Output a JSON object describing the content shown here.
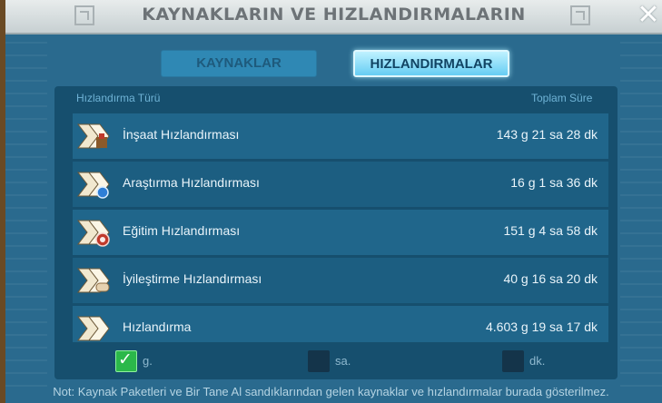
{
  "header": {
    "title": "KAYNAKLARIN VE HIZLANDIRMALARIN",
    "close_icon": "close-icon"
  },
  "tabs": [
    {
      "label": "KAYNAKLAR",
      "active": false
    },
    {
      "label": "HIZLANDIRMALAR",
      "active": true
    }
  ],
  "table": {
    "col_type": "Hızlandırma Türü",
    "col_total": "Toplam Süre",
    "rows": [
      {
        "label": "İnşaat Hızlandırması",
        "value": "143 g 21 sa 28 dk",
        "icon": "construction-speedup-icon"
      },
      {
        "label": "Araştırma Hızlandırması",
        "value": "16 g 1 sa 36 dk",
        "icon": "research-speedup-icon"
      },
      {
        "label": "Eğitim Hızlandırması",
        "value": "151 g 4 sa 58 dk",
        "icon": "training-speedup-icon"
      },
      {
        "label": "İyileştirme Hızlandırması",
        "value": "40 g 16 sa 20 dk",
        "icon": "healing-speedup-icon"
      },
      {
        "label": "Hızlandırma",
        "value": "4.603 g 19 sa 17 dk",
        "icon": "universal-speedup-icon"
      }
    ]
  },
  "units": [
    {
      "label": "g.",
      "checked": true
    },
    {
      "label": "sa.",
      "checked": false
    },
    {
      "label": "dk.",
      "checked": false
    }
  ],
  "note": "Not: Kaynak Paketleri ve Bir Tane Al sandıklarından gelen kaynaklar ve hızlandırmalar burada gösterilmez."
}
